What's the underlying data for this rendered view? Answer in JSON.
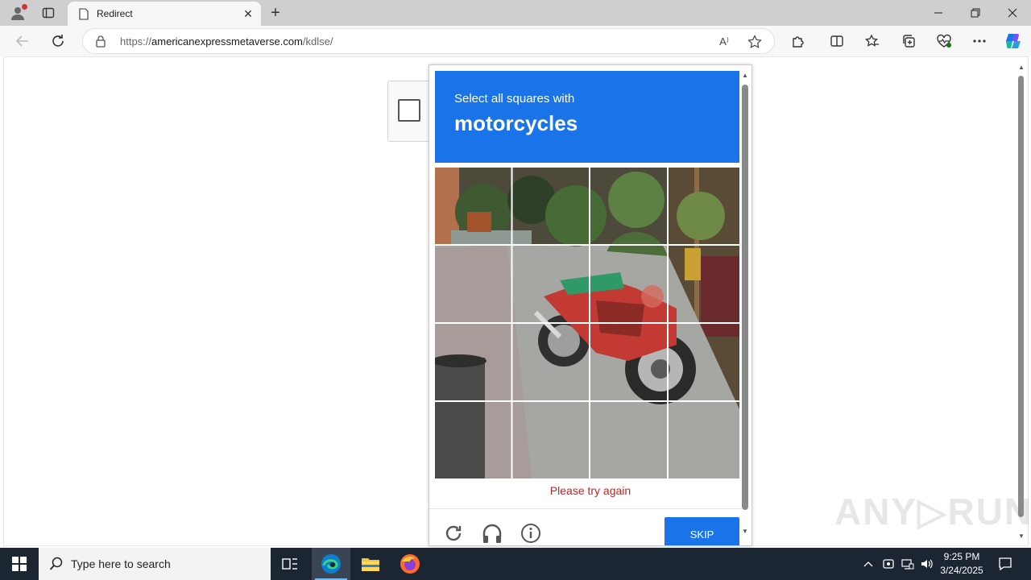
{
  "browser": {
    "tab_title": "Redirect",
    "url_prefix": "https://",
    "url_host": "americanexpressmetaverse.com",
    "url_path": "/kdlse/",
    "read_aloud_label": "A⁾"
  },
  "challenge": {
    "instruction_line1": "Select all squares with",
    "instruction_line2": "motorcycles",
    "error_text": "Please try again",
    "skip_label": "SKIP",
    "grid_rows": 4,
    "grid_cols": 4
  },
  "watermark": "ANY▷RUN",
  "taskbar": {
    "search_placeholder": "Type here to search",
    "time": "9:25 PM",
    "date": "3/24/2025"
  },
  "colors": {
    "accent": "#1a73e8",
    "error": "#c5221f",
    "taskbar": "#1c2633"
  }
}
